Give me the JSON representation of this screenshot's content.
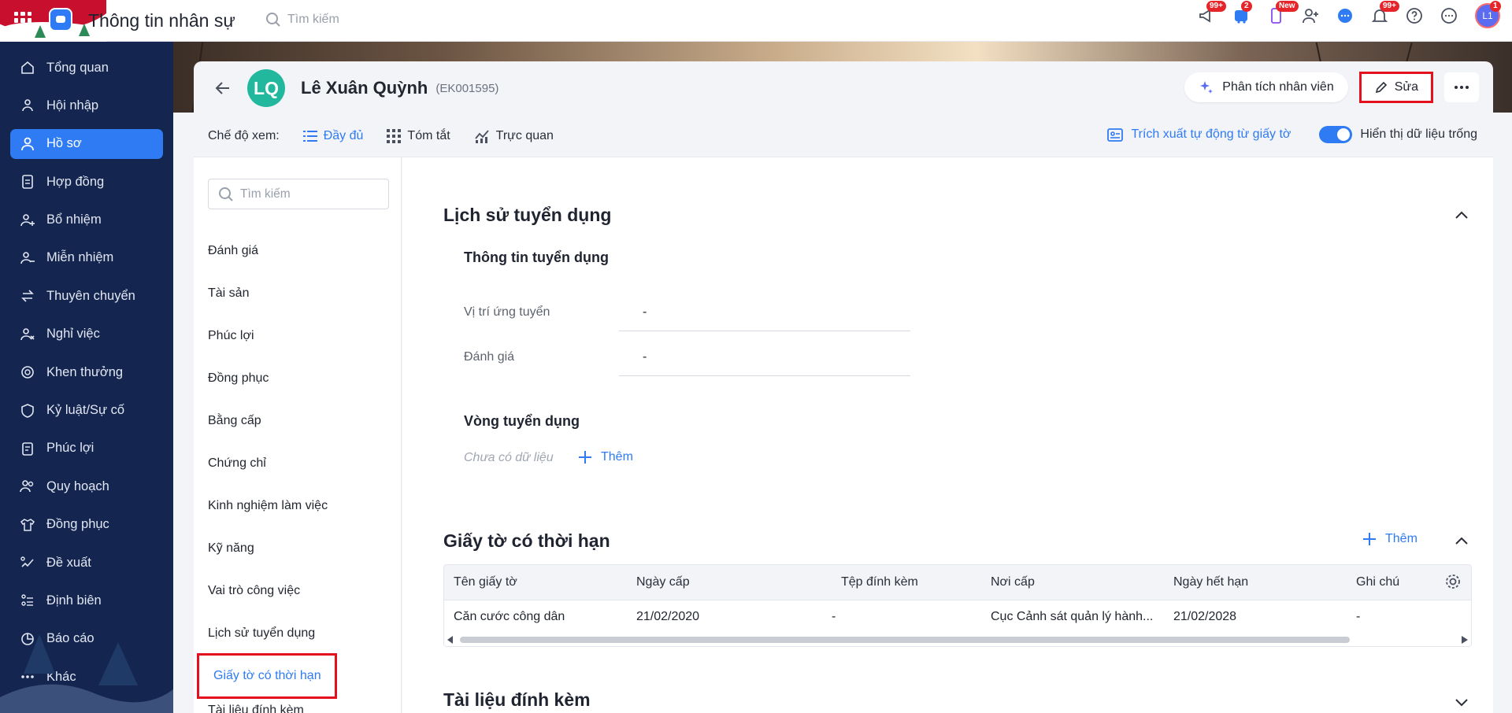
{
  "app": {
    "title": "Thông tin nhân sự",
    "search_placeholder": "Tìm kiếm"
  },
  "top_badges": {
    "megaphone": "99+",
    "cart": "2",
    "mobile": "New",
    "bell": "99+",
    "avatar": "1",
    "avatar_initials": "L1"
  },
  "sidebar": {
    "items": [
      {
        "label": "Tổng quan",
        "icon": "home-icon"
      },
      {
        "label": "Hội nhập",
        "icon": "people-icon"
      },
      {
        "label": "Hồ sơ",
        "icon": "user-icon",
        "active": true
      },
      {
        "label": "Hợp đồng",
        "icon": "document-icon"
      },
      {
        "label": "Bổ nhiệm",
        "icon": "user-plus-icon"
      },
      {
        "label": "Miễn nhiệm",
        "icon": "user-minus-icon"
      },
      {
        "label": "Thuyên chuyển",
        "icon": "transfer-icon"
      },
      {
        "label": "Nghỉ việc",
        "icon": "user-x-icon"
      },
      {
        "label": "Khen thưởng",
        "icon": "reward-icon"
      },
      {
        "label": "Kỷ luật/Sự cố",
        "icon": "shield-icon"
      },
      {
        "label": "Phúc lợi",
        "icon": "clipboard-icon"
      },
      {
        "label": "Quy hoạch",
        "icon": "users-icon"
      },
      {
        "label": "Đồng phục",
        "icon": "shirt-icon"
      },
      {
        "label": "Đề xuất",
        "icon": "proposal-icon"
      },
      {
        "label": "Định biên",
        "icon": "org-icon"
      },
      {
        "label": "Báo cáo",
        "icon": "chart-icon"
      },
      {
        "label": "Khác",
        "icon": "dots-icon"
      }
    ]
  },
  "header": {
    "initials": "LQ",
    "name": "Lê Xuân Quỳnh",
    "code": "(EK001595)",
    "analyze_label": "Phân tích nhân viên",
    "edit_label": "Sửa"
  },
  "viewbar": {
    "label": "Chế độ xem:",
    "options": [
      "Đầy đủ",
      "Tóm tắt",
      "Trực quan"
    ],
    "extract_label": "Trích xuất tự động từ giấy tờ",
    "toggle_label": "Hiển thị dữ liệu trống"
  },
  "secnav": {
    "search_placeholder": "Tìm kiếm",
    "items": [
      "Đánh giá",
      "Tài sản",
      "Phúc lợi",
      "Đồng phục",
      "Bằng cấp",
      "Chứng chỉ",
      "Kinh nghiệm làm việc",
      "Kỹ năng",
      "Vai trò công việc",
      "Lịch sử tuyển dụng",
      "Giấy tờ có thời hạn",
      "Tài liệu đính kèm"
    ]
  },
  "recruit": {
    "title": "Lịch sử tuyển dụng",
    "info_title": "Thông tin tuyển dụng",
    "position_label": "Vị trí ứng tuyển",
    "position_value": "-",
    "rating_label": "Đánh giá",
    "rating_value": "-",
    "round_title": "Vòng tuyển dụng",
    "nodata": "Chưa có dữ liệu",
    "add_label": "Thêm"
  },
  "docs": {
    "title": "Giấy tờ có thời hạn",
    "add_label": "Thêm",
    "columns": [
      "Tên giấy tờ",
      "Ngày cấp",
      "Tệp đính kèm",
      "Nơi cấp",
      "Ngày hết hạn",
      "Ghi chú"
    ],
    "rows": [
      [
        "Căn cước công dân",
        "21/02/2020",
        "-",
        "Cục Cảnh sát quản lý hành...",
        "21/02/2028",
        "-"
      ]
    ]
  },
  "attachments": {
    "title": "Tài liệu đính kèm"
  }
}
